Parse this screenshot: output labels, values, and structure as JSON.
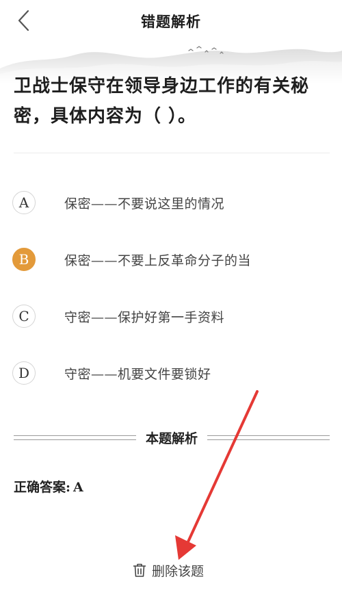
{
  "header": {
    "title": "错题解析"
  },
  "question": {
    "text": "卫战士保守在领导身边工作的有关秘密，具体内容为（    ）。"
  },
  "options": [
    {
      "letter": "A",
      "text": "保密——不要说这里的情况",
      "selected": false
    },
    {
      "letter": "B",
      "text": "保密——不要上反革命分子的当",
      "selected": true
    },
    {
      "letter": "C",
      "text": "守密——保护好第一手资料",
      "selected": false
    },
    {
      "letter": "D",
      "text": "守密——机要文件要锁好",
      "selected": false
    }
  ],
  "analysis": {
    "title": "本题解析",
    "answer_label": "正确答案:",
    "answer_value": "A"
  },
  "footer": {
    "delete_label": "删除该题"
  },
  "colors": {
    "selected_option": "#e39a3a",
    "annotation_arrow": "#e53935"
  },
  "icons": {
    "back": "chevron-left-icon",
    "delete": "trash-icon"
  }
}
